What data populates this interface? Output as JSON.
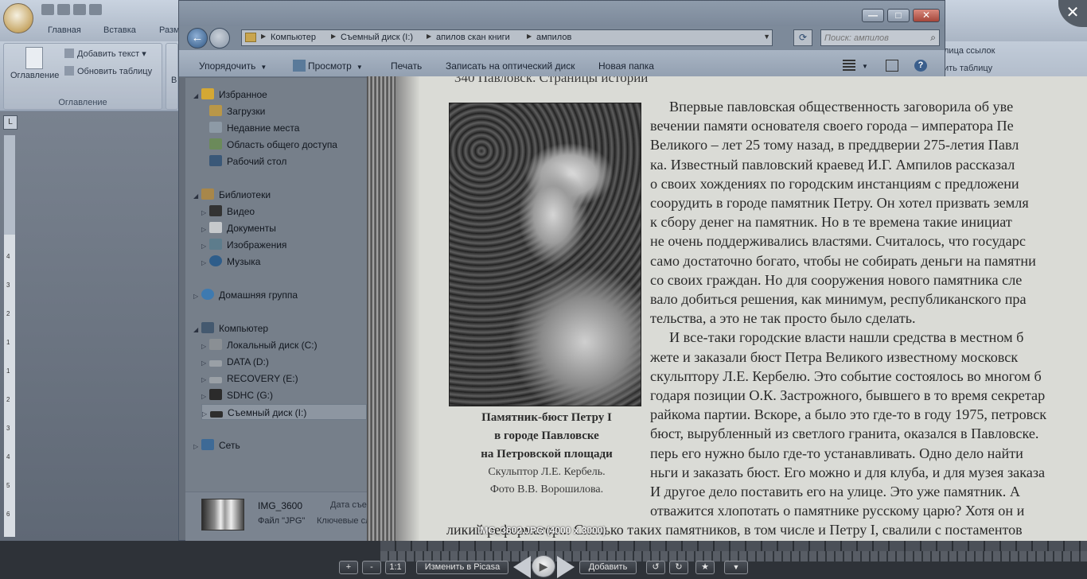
{
  "word": {
    "tabs": [
      "Главная",
      "Вставка",
      "Разм"
    ],
    "group_toc": {
      "big_button": "Оглавление",
      "add_text": "Добавить текст",
      "update_table": "Обновить таблицу",
      "label": "Оглавление",
      "next_letter": "В"
    },
    "right_group": {
      "item1": "лица ссылок",
      "item2": "ить таблицу"
    },
    "ruler_button": "L",
    "ruler_numbers": [
      "4",
      "3",
      "2",
      "1",
      "1",
      "2",
      "3",
      "4",
      "5",
      "6"
    ]
  },
  "explorer": {
    "window_buttons": {
      "minimize": "—",
      "maximize": "□",
      "close": "✕"
    },
    "back_arrow": "←",
    "breadcrumb": [
      "Компьютер",
      "Съемный диск (I:)",
      "апилов скан книги",
      "ампилов"
    ],
    "search_placeholder": "Поиск: ампилов",
    "toolbar": {
      "organize": "Упорядочить",
      "view": "Просмотр",
      "print": "Печать",
      "burn": "Записать на оптический диск",
      "new_folder": "Новая папка"
    },
    "nav": {
      "favorites": "Избранное",
      "downloads": "Загрузки",
      "recent": "Недавние места",
      "public": "Область общего доступа",
      "desktop": "Рабочий стол",
      "libraries": "Библиотеки",
      "video": "Видео",
      "documents": "Документы",
      "pictures": "Изображения",
      "music": "Музыка",
      "homegroup": "Домашняя группа",
      "computer": "Компьютер",
      "drive_c": "Локальный диск (C:)",
      "drive_d": "DATA (D:)",
      "drive_e": "RECOVERY (E:)",
      "drive_g": "SDHC (G:)",
      "drive_i": "Съемный диск (I:)",
      "network": "Сеть"
    },
    "details": {
      "name": "IMG_3600",
      "type": "Файл \"JPG\"",
      "date": "Дата съе",
      "keywords": "Ключевые сл"
    }
  },
  "viewer": {
    "close": "✕",
    "running_head": "340    Павловск. Страницы истории",
    "caption_bold": [
      "Памятник-бюст Петру I",
      "в городе Павловске",
      "на Петровской площади"
    ],
    "caption_regular": [
      "Скульптор Л.Е. Кербель.",
      "Фото В.В. Ворошилова."
    ],
    "body_lines": [
      "Впервые павловская общественность заговорила об уве",
      "вечении памяти основателя своего города – императора Пе",
      "Великого – лет 25 тому назад, в преддверии 275-летия Павл",
      "ка. Известный павловский краевед И.Г. Ампилов рассказал",
      "о своих хождениях по городским инстанциям с предложени",
      "соорудить в городе памятник Петру. Он хотел призвать земля",
      "к сбору денег на памятник. Но в те времена такие инициат",
      "не очень поддерживались властями. Считалось, что государс",
      "само достаточно богато, чтобы не собирать деньги на памятни",
      "со своих граждан. Но для сооружения нового памятника сле",
      "вало добиться решения, как минимум, республиканского пра",
      "тельства, а это не так просто было сделать.",
      "И все-таки городские власти нашли средства в местном б",
      "жете и заказали бюст Петра Великого известному московск",
      "скульптору Л.Е. Кербелю. Это событие состоялось во многом б",
      "годаря позиции О.К. Застрожного, бывшего в то время секретар",
      "райкома партии. Вскоре, а было это где-то в году 1975, петровск",
      "бюст, вырубленный из светлого гранита, оказался в Павловске.",
      "перь его нужно было где-то устанавливать. Одно дело найти",
      "ньги и заказать бюст. Его можно и для клуба, и для музея заказа",
      "И другое дело поставить его на улице. Это уже памятник. А",
      "отважится хлопотать о памятнике русскому царю? Хотя он и"
    ],
    "bottom_line": "ликий реформатор... Сколько таких памятников, в том числе и Петру I, свалили с постаментов",
    "image_label": "IMG_3602.JPG (4000 x 3000)",
    "controls": {
      "zoom_in": "+",
      "zoom_out": "-",
      "actual_size": "1:1",
      "edit": "Изменить в Picasa",
      "play": "▶",
      "add": "Добавить",
      "rotate_left": "↺",
      "rotate_right": "↻",
      "star": "★",
      "more": "▼"
    }
  }
}
